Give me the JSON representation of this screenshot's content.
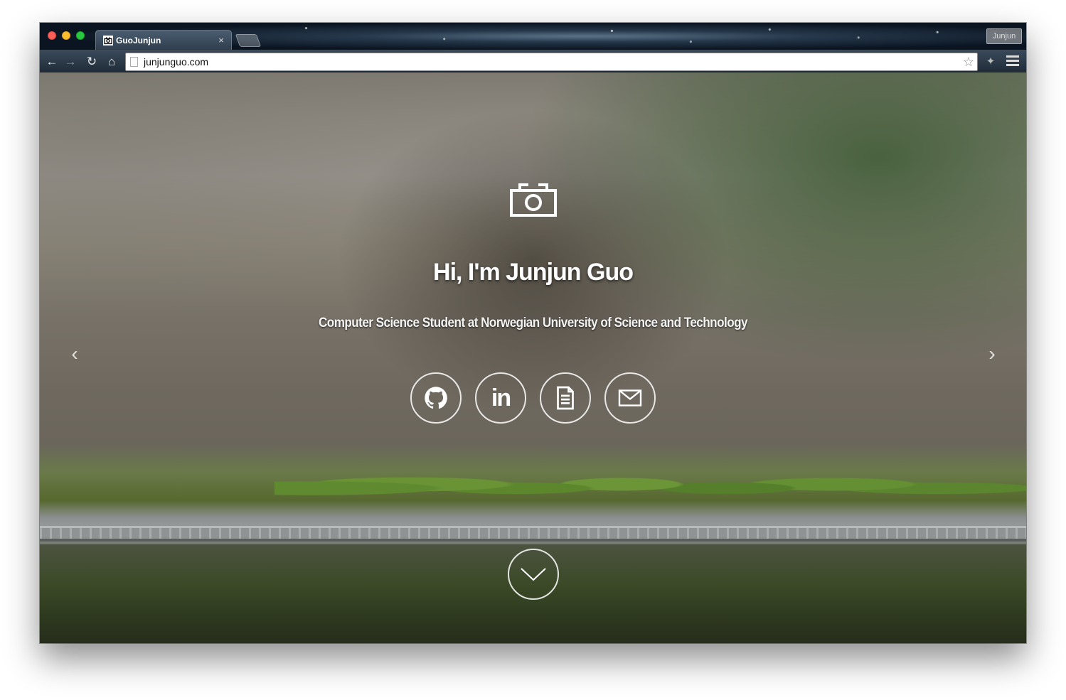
{
  "browser": {
    "tab_title": "GuoJunjun",
    "tab_close": "×",
    "profile_name": "Junjun",
    "url": "junjunguo.com",
    "icons": {
      "back": "back-arrow-icon",
      "forward": "forward-arrow-icon",
      "reload": "reload-icon",
      "home": "home-icon",
      "bookmark": "star-icon",
      "extension": "extension-icon",
      "menu": "hamburger-menu-icon"
    }
  },
  "hero": {
    "title": "Hi, I'm Junjun Guo",
    "subtitle": "Computer Science Student at Norwegian University of Science and Technology",
    "prev_arrow": "‹",
    "next_arrow": "›",
    "social": [
      {
        "name": "github",
        "icon": "github-icon"
      },
      {
        "name": "linkedin",
        "icon": "linkedin-icon",
        "text": "in"
      },
      {
        "name": "resume",
        "icon": "document-icon"
      },
      {
        "name": "email",
        "icon": "envelope-icon"
      }
    ],
    "scroll_icon": "chevron-down-icon"
  }
}
